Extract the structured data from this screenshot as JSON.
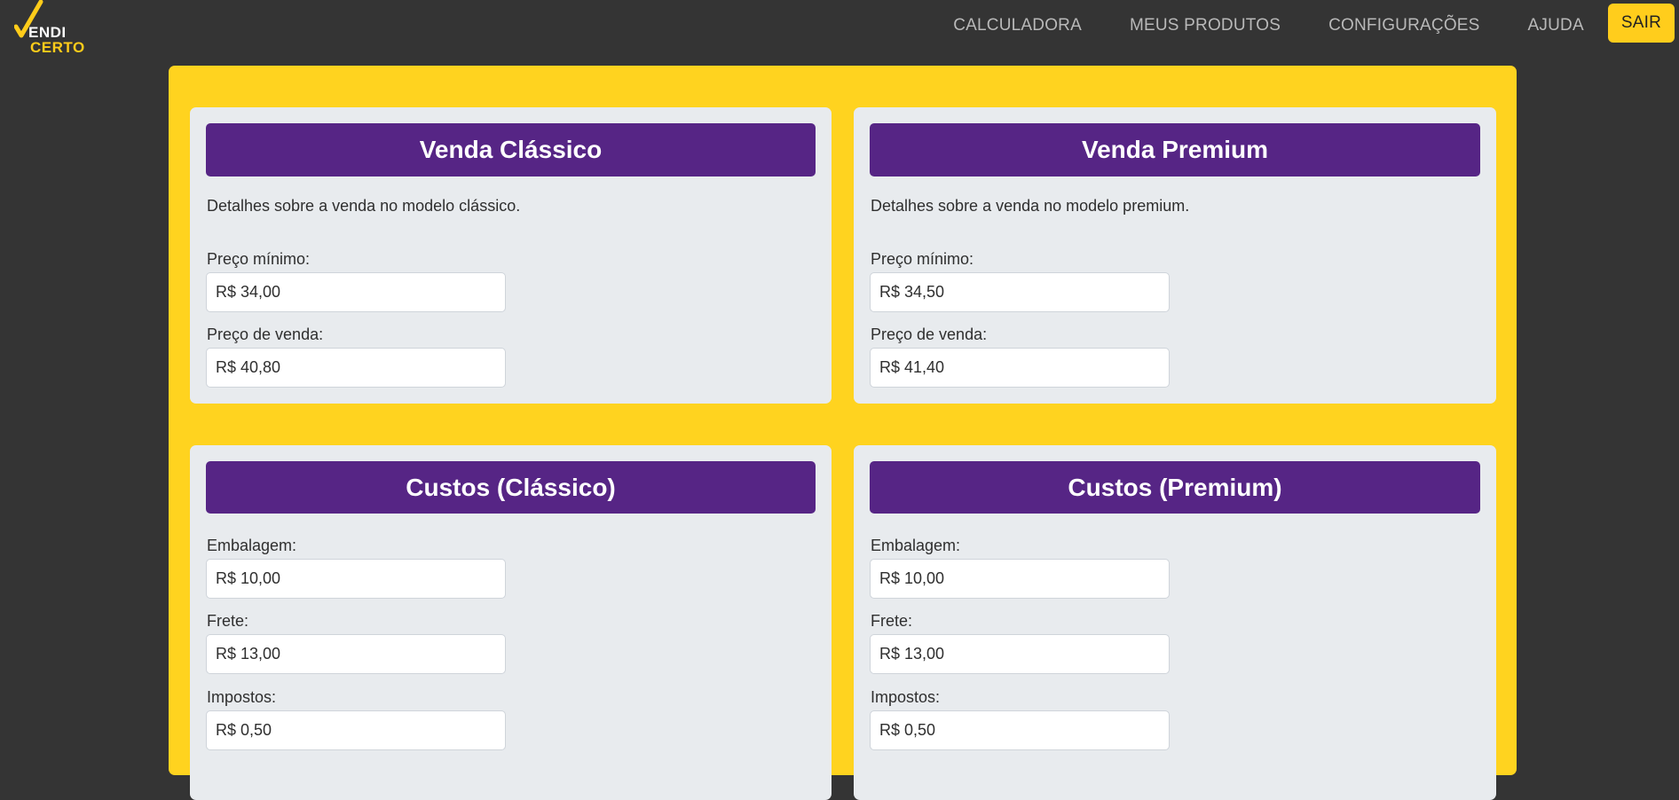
{
  "brand": {
    "line1": "ENDI",
    "line2": "CERTO"
  },
  "nav": {
    "items": [
      "CALCULADORA",
      "MEUS PRODUTOS",
      "CONFIGURAÇÕES",
      "AJUDA"
    ],
    "logout": "SAIR"
  },
  "classic": {
    "title": "Venda Clássico",
    "description": "Detalhes sobre a venda no modelo clássico.",
    "min_label": "Preço mínimo:",
    "min_value": "R$ 34,00",
    "sale_label": "Preço de venda:",
    "sale_value": "R$ 40,80"
  },
  "premium": {
    "title": "Venda Premium",
    "description": "Detalhes sobre a venda no modelo premium.",
    "min_label": "Preço mínimo:",
    "min_value": "R$ 34,50",
    "sale_label": "Preço de venda:",
    "sale_value": "R$ 41,40"
  },
  "costs_classic": {
    "title": "Custos (Clássico)",
    "packaging_label": "Embalagem:",
    "packaging_value": "R$ 10,00",
    "shipping_label": "Frete:",
    "shipping_value": "R$ 13,00",
    "taxes_label": "Impostos:",
    "taxes_value": "R$ 0,50"
  },
  "costs_premium": {
    "title": "Custos (Premium)",
    "packaging_label": "Embalagem:",
    "packaging_value": "R$ 10,00",
    "shipping_label": "Frete:",
    "shipping_value": "R$ 13,00",
    "taxes_label": "Impostos:",
    "taxes_value": "R$ 0,50"
  },
  "colors": {
    "background": "#343434",
    "accent": "#ffd31f",
    "header": "#562585",
    "card": "#e8ebee"
  }
}
